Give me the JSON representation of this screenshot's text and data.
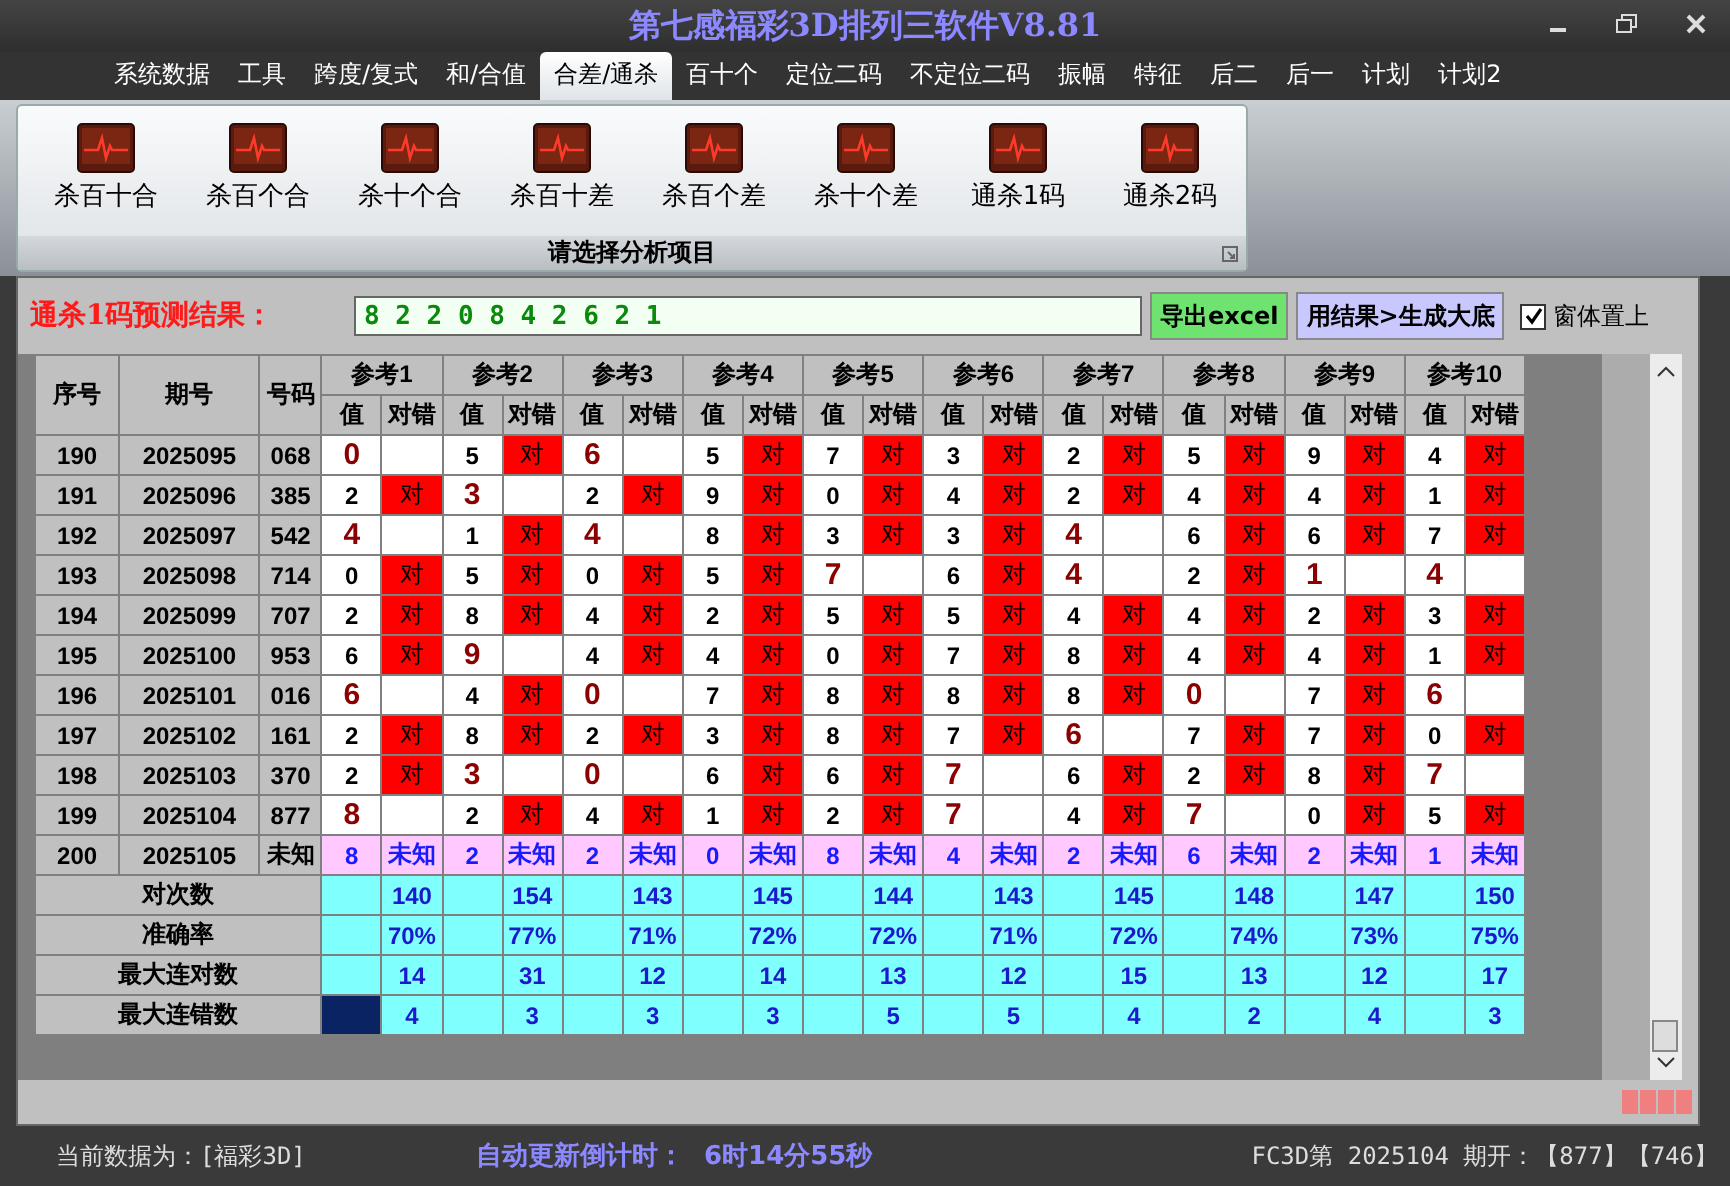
{
  "window": {
    "title": "第七感福彩3D排列三软件V8.81"
  },
  "menu": [
    {
      "label": "系统数据",
      "selected": false
    },
    {
      "label": "工具",
      "selected": false
    },
    {
      "label": "跨度/复式",
      "selected": false
    },
    {
      "label": "和/合值",
      "selected": false
    },
    {
      "label": "合差/通杀",
      "selected": true
    },
    {
      "label": "百十个",
      "selected": false
    },
    {
      "label": "定位二码",
      "selected": false
    },
    {
      "label": "不定位二码",
      "selected": false
    },
    {
      "label": "振幅",
      "selected": false
    },
    {
      "label": "特征",
      "selected": false
    },
    {
      "label": "后二",
      "selected": false
    },
    {
      "label": "后一",
      "selected": false
    },
    {
      "label": "计划",
      "selected": false
    },
    {
      "label": "计划2",
      "selected": false
    }
  ],
  "ribbon": {
    "buttons": [
      "杀百十合",
      "杀百个合",
      "杀十个合",
      "杀百十差",
      "杀百个差",
      "杀十个差",
      "通杀1码",
      "通杀2码"
    ],
    "group_label": "请选择分析项目"
  },
  "prediction": {
    "label": "通杀1码预测结果：",
    "value": "8 2 2 0 8 4 2 6 2 1",
    "export_button": "导出excel",
    "generate_button": "用结果>生成大底",
    "stay_on_top": {
      "label": "窗体置上",
      "checked": true
    }
  },
  "table": {
    "columns": [
      "序号",
      "期号",
      "号码"
    ],
    "ref_groups": [
      {
        "label": "参考1",
        "value_header": "值",
        "result_header": "对错"
      },
      {
        "label": "参考2",
        "value_header": "值",
        "result_header": "对错"
      },
      {
        "label": "参考3",
        "value_header": "值",
        "result_header": "对错"
      },
      {
        "label": "参考4",
        "value_header": "值",
        "result_header": "对错"
      },
      {
        "label": "参考5",
        "value_header": "值",
        "result_header": "对错"
      },
      {
        "label": "参考6",
        "value_header": "值",
        "result_header": "对错"
      },
      {
        "label": "参考7",
        "value_header": "值",
        "result_header": "对错"
      },
      {
        "label": "参考8",
        "value_header": "值",
        "result_header": "对错"
      },
      {
        "label": "参考9",
        "value_header": "值",
        "result_header": "对错"
      },
      {
        "label": "参考10",
        "value_header": "值",
        "result_header": "对错"
      }
    ],
    "rows": [
      {
        "kind": "history",
        "index": "190",
        "period": "2025095",
        "number": "068",
        "cells": [
          {
            "value": "0"
          },
          {
            "value": "5",
            "result": "对"
          },
          {
            "value": "6"
          },
          {
            "value": "5",
            "result": "对"
          },
          {
            "value": "7",
            "result": "对"
          },
          {
            "value": "3",
            "result": "对"
          },
          {
            "value": "2",
            "result": "对"
          },
          {
            "value": "5",
            "result": "对"
          },
          {
            "value": "9",
            "result": "对"
          },
          {
            "value": "4",
            "result": "对"
          }
        ]
      },
      {
        "kind": "history",
        "index": "191",
        "period": "2025096",
        "number": "385",
        "cells": [
          {
            "value": "2",
            "result": "对"
          },
          {
            "value": "3"
          },
          {
            "value": "2",
            "result": "对"
          },
          {
            "value": "9",
            "result": "对"
          },
          {
            "value": "0",
            "result": "对"
          },
          {
            "value": "4",
            "result": "对"
          },
          {
            "value": "2",
            "result": "对"
          },
          {
            "value": "4",
            "result": "对"
          },
          {
            "value": "4",
            "result": "对"
          },
          {
            "value": "1",
            "result": "对"
          }
        ]
      },
      {
        "kind": "history",
        "index": "192",
        "period": "2025097",
        "number": "542",
        "cells": [
          {
            "value": "4"
          },
          {
            "value": "1",
            "result": "对"
          },
          {
            "value": "4"
          },
          {
            "value": "8",
            "result": "对"
          },
          {
            "value": "3",
            "result": "对"
          },
          {
            "value": "3",
            "result": "对"
          },
          {
            "value": "4"
          },
          {
            "value": "6",
            "result": "对"
          },
          {
            "value": "6",
            "result": "对"
          },
          {
            "value": "7",
            "result": "对"
          }
        ]
      },
      {
        "kind": "history",
        "index": "193",
        "period": "2025098",
        "number": "714",
        "cells": [
          {
            "value": "0",
            "result": "对"
          },
          {
            "value": "5",
            "result": "对"
          },
          {
            "value": "0",
            "result": "对"
          },
          {
            "value": "5",
            "result": "对"
          },
          {
            "value": "7"
          },
          {
            "value": "6",
            "result": "对"
          },
          {
            "value": "4"
          },
          {
            "value": "2",
            "result": "对"
          },
          {
            "value": "1"
          },
          {
            "value": "4"
          }
        ]
      },
      {
        "kind": "history",
        "index": "194",
        "period": "2025099",
        "number": "707",
        "cells": [
          {
            "value": "2",
            "result": "对"
          },
          {
            "value": "8",
            "result": "对"
          },
          {
            "value": "4",
            "result": "对"
          },
          {
            "value": "2",
            "result": "对"
          },
          {
            "value": "5",
            "result": "对"
          },
          {
            "value": "5",
            "result": "对"
          },
          {
            "value": "4",
            "result": "对"
          },
          {
            "value": "4",
            "result": "对"
          },
          {
            "value": "2",
            "result": "对"
          },
          {
            "value": "3",
            "result": "对"
          }
        ]
      },
      {
        "kind": "history",
        "index": "195",
        "period": "2025100",
        "number": "953",
        "cells": [
          {
            "value": "6",
            "result": "对"
          },
          {
            "value": "9"
          },
          {
            "value": "4",
            "result": "对"
          },
          {
            "value": "4",
            "result": "对"
          },
          {
            "value": "0",
            "result": "对"
          },
          {
            "value": "7",
            "result": "对"
          },
          {
            "value": "8",
            "result": "对"
          },
          {
            "value": "4",
            "result": "对"
          },
          {
            "value": "4",
            "result": "对"
          },
          {
            "value": "1",
            "result": "对"
          }
        ]
      },
      {
        "kind": "history",
        "index": "196",
        "period": "2025101",
        "number": "016",
        "cells": [
          {
            "value": "6"
          },
          {
            "value": "4",
            "result": "对"
          },
          {
            "value": "0"
          },
          {
            "value": "7",
            "result": "对"
          },
          {
            "value": "8",
            "result": "对"
          },
          {
            "value": "8",
            "result": "对"
          },
          {
            "value": "8",
            "result": "对"
          },
          {
            "value": "0"
          },
          {
            "value": "7",
            "result": "对"
          },
          {
            "value": "6"
          }
        ]
      },
      {
        "kind": "history",
        "index": "197",
        "period": "2025102",
        "number": "161",
        "cells": [
          {
            "value": "2",
            "result": "对"
          },
          {
            "value": "8",
            "result": "对"
          },
          {
            "value": "2",
            "result": "对"
          },
          {
            "value": "3",
            "result": "对"
          },
          {
            "value": "8",
            "result": "对"
          },
          {
            "value": "7",
            "result": "对"
          },
          {
            "value": "6"
          },
          {
            "value": "7",
            "result": "对"
          },
          {
            "value": "7",
            "result": "对"
          },
          {
            "value": "0",
            "result": "对"
          }
        ]
      },
      {
        "kind": "history",
        "index": "198",
        "period": "2025103",
        "number": "370",
        "cells": [
          {
            "value": "2",
            "result": "对"
          },
          {
            "value": "3"
          },
          {
            "value": "0"
          },
          {
            "value": "6",
            "result": "对"
          },
          {
            "value": "6",
            "result": "对"
          },
          {
            "value": "7"
          },
          {
            "value": "6",
            "result": "对"
          },
          {
            "value": "2",
            "result": "对"
          },
          {
            "value": "8",
            "result": "对"
          },
          {
            "value": "7"
          }
        ]
      },
      {
        "kind": "history",
        "index": "199",
        "period": "2025104",
        "number": "877",
        "cells": [
          {
            "value": "8"
          },
          {
            "value": "2",
            "result": "对"
          },
          {
            "value": "4",
            "result": "对"
          },
          {
            "value": "1",
            "result": "对"
          },
          {
            "value": "2",
            "result": "对"
          },
          {
            "value": "7"
          },
          {
            "value": "4",
            "result": "对"
          },
          {
            "value": "7"
          },
          {
            "value": "0",
            "result": "对"
          },
          {
            "value": "5",
            "result": "对"
          }
        ]
      },
      {
        "kind": "pending",
        "index": "200",
        "period": "2025105",
        "number": "未知",
        "cells": [
          {
            "value": "8",
            "result": "未知"
          },
          {
            "value": "2",
            "result": "未知"
          },
          {
            "value": "2",
            "result": "未知"
          },
          {
            "value": "0",
            "result": "未知"
          },
          {
            "value": "8",
            "result": "未知"
          },
          {
            "value": "4",
            "result": "未知"
          },
          {
            "value": "2",
            "result": "未知"
          },
          {
            "value": "6",
            "result": "未知"
          },
          {
            "value": "2",
            "result": "未知"
          },
          {
            "value": "1",
            "result": "未知"
          }
        ]
      }
    ],
    "stats": [
      {
        "label": "对次数",
        "selected": false,
        "values": [
          "140",
          "154",
          "143",
          "145",
          "144",
          "143",
          "145",
          "148",
          "147",
          "150"
        ]
      },
      {
        "label": "准确率",
        "selected": false,
        "values": [
          "70%",
          "77%",
          "71%",
          "72%",
          "72%",
          "71%",
          "72%",
          "74%",
          "73%",
          "75%"
        ]
      },
      {
        "label": "最大连对数",
        "selected": false,
        "values": [
          "14",
          "31",
          "12",
          "14",
          "13",
          "12",
          "15",
          "13",
          "12",
          "17"
        ]
      },
      {
        "label": "最大连错数",
        "selected": true,
        "values": [
          "4",
          "3",
          "3",
          "3",
          "5",
          "5",
          "4",
          "2",
          "4",
          "3"
        ]
      }
    ]
  },
  "status_bar": {
    "data_source": "当前数据为：[福彩3D]",
    "countdown_label": "自动更新倒计时：",
    "countdown": "6时14分55秒",
    "draw_info": "FC3D第 2025104 期开：【877】【746】"
  }
}
